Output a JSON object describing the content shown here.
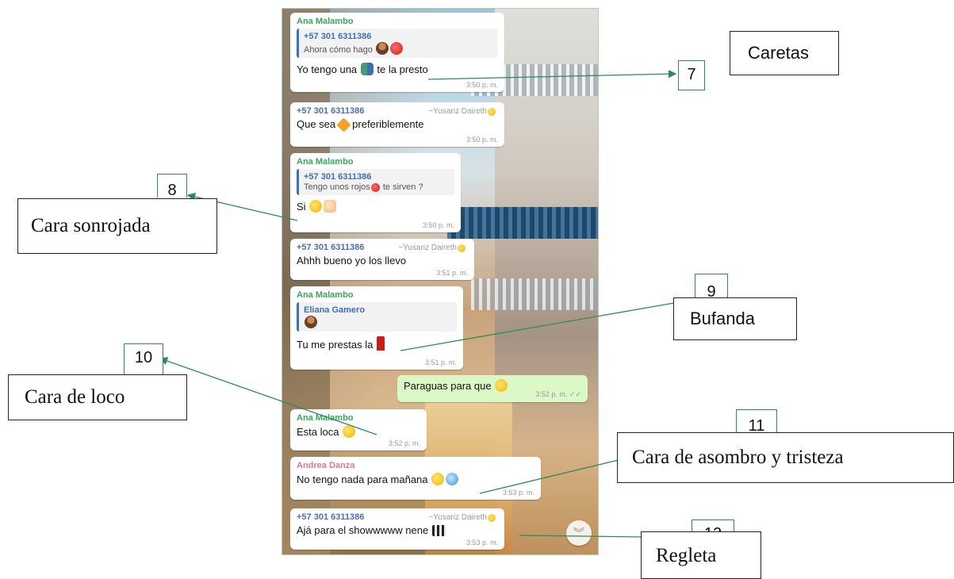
{
  "chat": {
    "messages": [
      {
        "sender": "Ana Malambo",
        "quote_author": "+57 301 6311386",
        "quote_text": "Ahora cómo hago",
        "text_before": "Yo tengo una",
        "text_after": "te la presto",
        "time": "3:50 p. m."
      },
      {
        "sender": "+57 301 6311386",
        "alias": "~Yusariz Daireth",
        "text_before": "Que sea",
        "text_after": "preferiblemente",
        "time": "3:50 p. m."
      },
      {
        "sender": "Ana Malambo",
        "quote_author": "+57 301 6311386",
        "quote_text": "Tengo unos rojos",
        "quote_text_after": "te sirven ?",
        "text_before": "Si",
        "time": "3:50 p. m."
      },
      {
        "sender": "+57 301 6311386",
        "alias": "~Yusariz Daireth",
        "text_before": "Ahhh bueno yo los llevo",
        "time": "3:51 p. m."
      },
      {
        "sender": "Ana Malambo",
        "quote_author": "Eliana Gamero",
        "text_before": "Tu me prestas la",
        "time": "3:51 p. m."
      },
      {
        "outgoing": true,
        "text_before": "Paraguas para que",
        "time": "3:52 p. m."
      },
      {
        "sender": "Ana Malambo",
        "text_before": "Esta loca",
        "time": "3:52 p. m."
      },
      {
        "sender": "Andrea Danza",
        "text_before": "No tengo nada para mañana",
        "time": "3:53 p. m."
      },
      {
        "sender": "+57 301 6311386",
        "alias": "~Yusariz Daireth",
        "text_before": "Ajá para el showwwww nene",
        "time": "3:53 p. m."
      }
    ],
    "scroll_down_icon": "chevron-double-down-icon"
  },
  "annotations": {
    "caretas": "Caretas",
    "caretas_num": "7",
    "sonrojada": "Cara sonrojada",
    "sonrojada_num": "8",
    "bufanda": "Bufanda",
    "bufanda_num": "9",
    "loco": "Cara de loco",
    "loco_num": "10",
    "asombro": "Cara de asombro y tristeza",
    "asombro_num": "11",
    "regleta": "Regleta",
    "regleta_num": "12"
  },
  "colors": {
    "sender_green": "#3aa55b",
    "quote_blue": "#3f6fb6",
    "outgoing_bubble": "#dcf8c6",
    "arrow_green": "#2e8b57"
  }
}
